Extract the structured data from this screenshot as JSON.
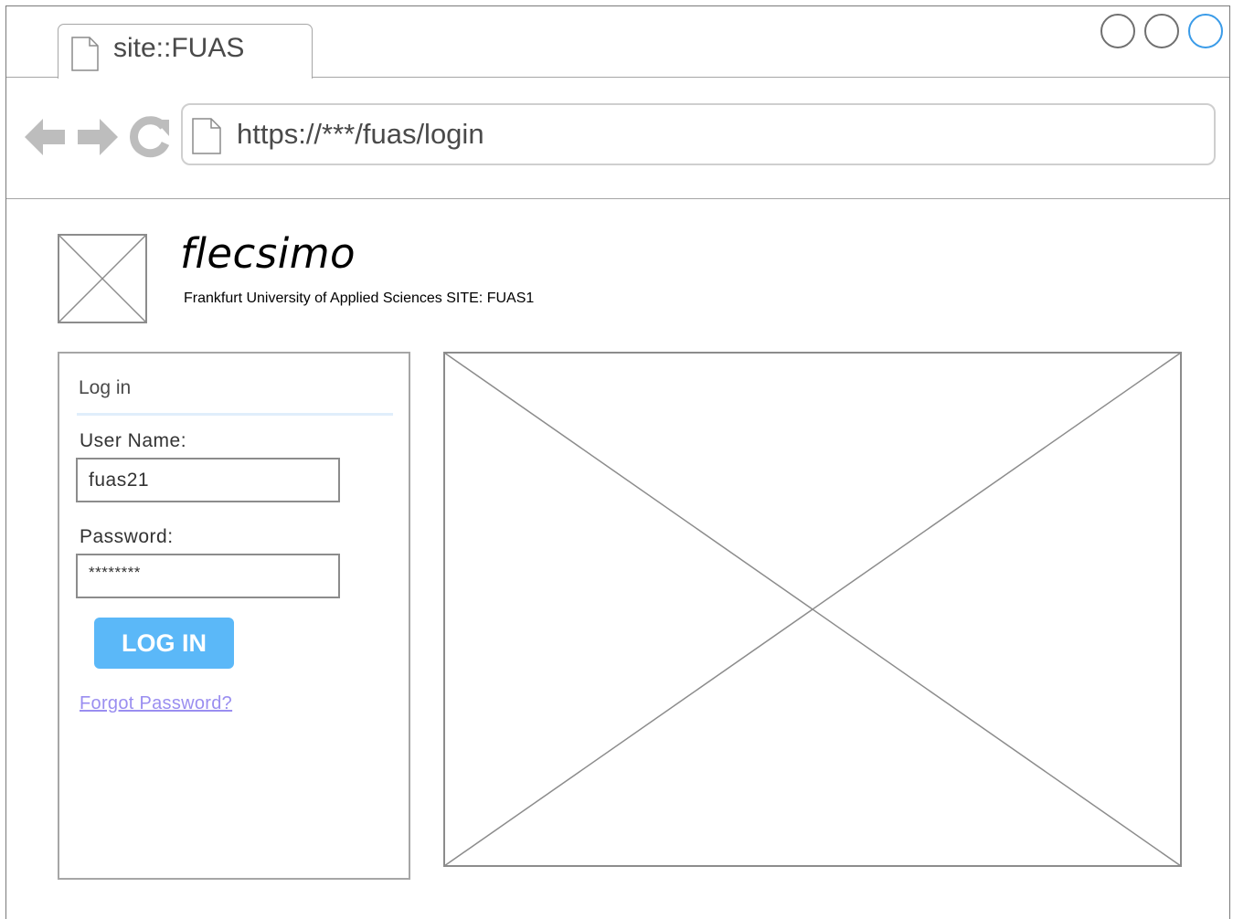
{
  "window": {
    "tab_title": "site::FUAS",
    "controls": [
      "minimize-circle",
      "maximize-circle",
      "close-circle"
    ],
    "active_control_color": "#3a9be8"
  },
  "nav": {
    "back_icon": "arrow-left-icon",
    "forward_icon": "arrow-right-icon",
    "reload_icon": "reload-icon",
    "url": "https://***/fuas/login"
  },
  "header": {
    "app_name": "flecsimo",
    "subtitle": "Frankfurt University of Applied Sciences SITE: FUAS1"
  },
  "login": {
    "heading": "Log in",
    "username_label": "User Name:",
    "username_value": "fuas21",
    "password_label": "Password:",
    "password_value": "********",
    "button_label": "LOG IN",
    "forgot_link": "Forgot Password?",
    "button_color": "#5bb8f8",
    "link_color": "#9a8ef0"
  }
}
